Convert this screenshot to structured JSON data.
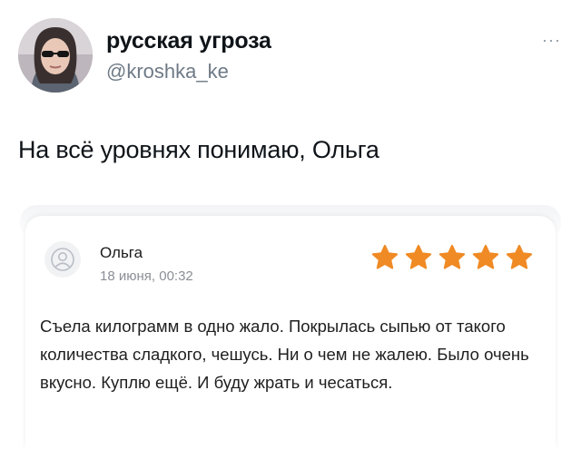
{
  "tweet": {
    "author_name": "русская угроза",
    "author_handle": "@kroshka_ke",
    "more_label": "···",
    "text": "На всё уровнях понимаю, Ольга"
  },
  "review": {
    "reviewer_name": "Ольга",
    "date": "18 июня, 00:32",
    "rating": 5,
    "rating_max": 5,
    "star_color": "#f08a24",
    "text": "Съела килограмм в одно жало. Покрылась сыпью от такого количества сладкого, чешусь. Ни о чем не жалею. Было очень вкусно. Куплю ещё. И буду жрать и чесаться."
  },
  "icons": {
    "avatar": "profile-photo",
    "reviewer_avatar": "user-circle-icon",
    "star": "star-icon",
    "more": "more-dots-icon"
  }
}
